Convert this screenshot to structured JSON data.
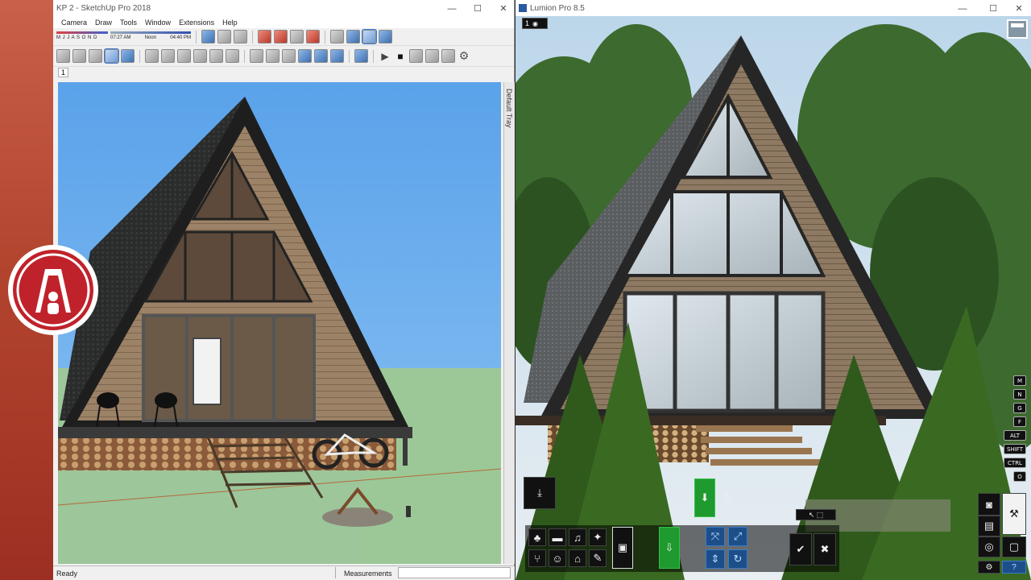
{
  "sketchup": {
    "title": "KP 2 - SketchUp Pro 2018",
    "menu": [
      "Camera",
      "Draw",
      "Tools",
      "Window",
      "Extensions",
      "Help"
    ],
    "shadow_months": "M J J A S O N D",
    "shadow_times": [
      "07:27 AM",
      "Noon",
      "04:40 PM"
    ],
    "scene_tab": "1",
    "tray_label": "Default Tray",
    "status_text": "Ready",
    "measurements_label": "Measurements"
  },
  "lumion": {
    "title": "Lumion Pro 8.5",
    "scene_number": "1",
    "key_buttons": [
      "M",
      "N",
      "G",
      "F",
      "ALT",
      "SHIFT",
      "CTRL",
      "O"
    ],
    "help_label": "?"
  },
  "colors": {
    "sketchup_sky": "#6fb0ee",
    "sketchup_ground": "#9dc69a",
    "lumion_green": "#1f9a2e",
    "lumion_blue": "#1c4f8a"
  }
}
